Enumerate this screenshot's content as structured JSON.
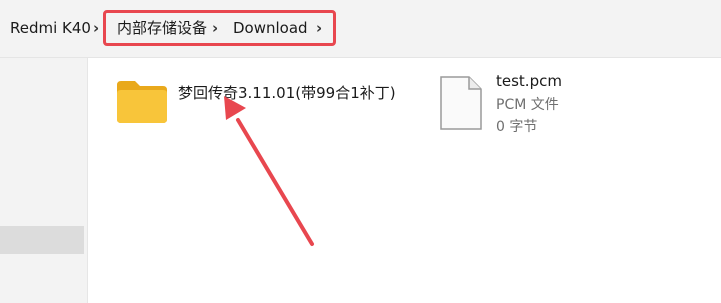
{
  "breadcrumb": {
    "items": [
      "Redmi K40",
      "内部存储设备",
      "Download"
    ],
    "separator": "›"
  },
  "files": [
    {
      "name": "梦回传奇3.11.01(带99合1补丁)",
      "type": "folder",
      "icon": "folder-icon"
    },
    {
      "name": "test.pcm",
      "type_label": "PCM 文件",
      "size": "0 字节",
      "icon": "file-icon"
    }
  ],
  "colors": {
    "annotation": "#e8474f",
    "folder": "#f8c53a",
    "topbar_bg": "#f3f3f3"
  }
}
